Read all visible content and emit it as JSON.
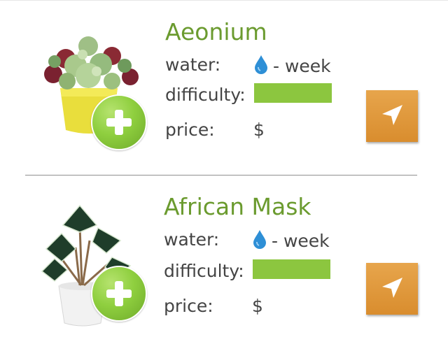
{
  "plants": [
    {
      "name": "Aeonium",
      "water_label": "water:",
      "water_value": "- week",
      "difficulty_label": "difficulty:",
      "difficulty_level": 1.0,
      "price_label": "price:",
      "price_value": "$",
      "add_icon": "plus-icon",
      "nav_icon": "navigation-arrow-icon"
    },
    {
      "name": "African Mask",
      "water_label": "water:",
      "water_value": "- week",
      "difficulty_label": "difficulty:",
      "difficulty_level": 1.0,
      "price_label": "price:",
      "price_value": "$",
      "add_icon": "plus-icon",
      "nav_icon": "navigation-arrow-icon"
    }
  ],
  "colors": {
    "plant_name": "#6b9b2f",
    "difficulty_bar": "#8cc63f",
    "water_drop": "#2e8fd6",
    "nav_button": "#df9a3c",
    "add_button": "#8fcf3f"
  }
}
